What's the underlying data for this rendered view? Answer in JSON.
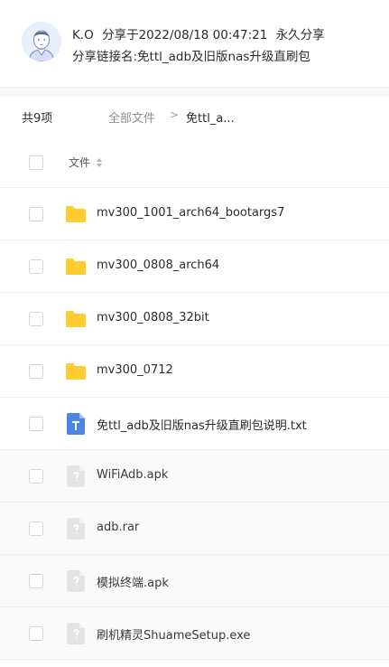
{
  "header": {
    "user": "K.O",
    "share_prefix": "分享于2022/08/18 00:47:21",
    "share_expiry": "永久分享",
    "link_name": "分享链接名:免ttl_adb及旧版nas升级直刷包"
  },
  "breadcrumb": {
    "count": "共9项",
    "root": "全部文件",
    "separator": ">",
    "current": "免ttl_a..."
  },
  "list": {
    "column_name": "文件",
    "files": [
      {
        "name": "mv300_1001_arch64_bootargs7",
        "type": "folder"
      },
      {
        "name": "mv300_0808_arch64",
        "type": "folder"
      },
      {
        "name": "mv300_0808_32bit",
        "type": "folder"
      },
      {
        "name": "mv300_0712",
        "type": "folder"
      },
      {
        "name": "免ttl_adb及旧版nas升级直刷包说明.txt",
        "type": "txt"
      },
      {
        "name": "WiFiAdb.apk",
        "type": "file"
      },
      {
        "name": "adb.rar",
        "type": "file"
      },
      {
        "name": "模拟终端.apk",
        "type": "file"
      },
      {
        "name": "刷机精灵ShuameSetup.exe",
        "type": "file"
      }
    ]
  },
  "colors": {
    "folder": "#ffcd32",
    "txt": "#4a86e8",
    "file_icon": "#e3e4e6"
  }
}
